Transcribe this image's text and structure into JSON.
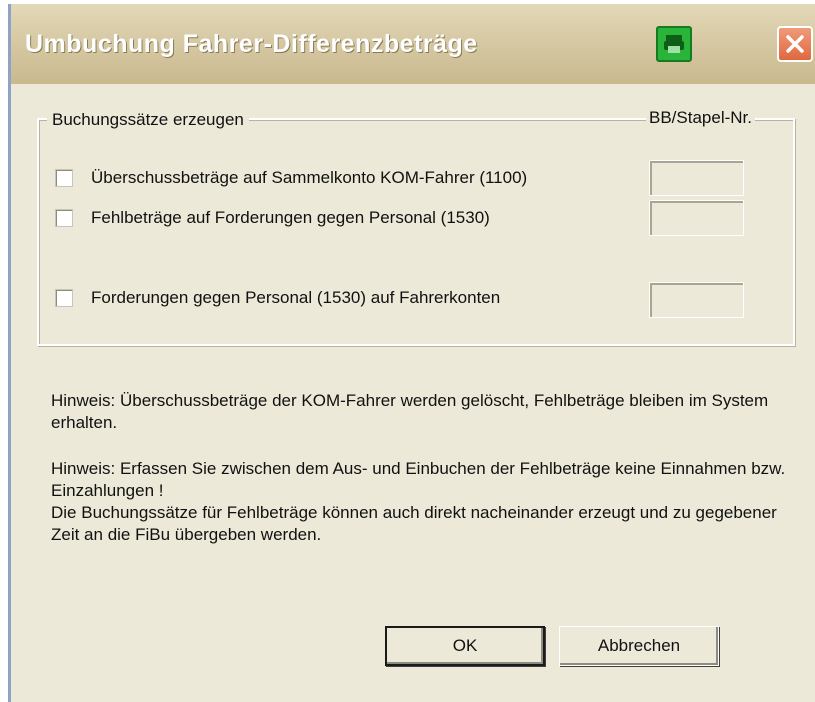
{
  "window": {
    "title": "Umbuchung Fahrer-Differenzbeträge"
  },
  "titlebar_icons": {
    "app_icon": "green-printer-icon",
    "close_icon": "close-x-icon",
    "close_color": "#e0683f"
  },
  "group": {
    "label": "Buchungssätze erzeugen",
    "column_header": "BB/Stapel-Nr.",
    "options": [
      {
        "label": "Überschussbeträge auf Sammelkonto KOM-Fahrer (1100)",
        "checked": false,
        "batch_number": ""
      },
      {
        "label": "Fehlbeträge auf Forderungen gegen Personal (1530)",
        "checked": false,
        "batch_number": ""
      },
      {
        "label": "Forderungen gegen Personal (1530) auf Fahrerkonten",
        "checked": false,
        "batch_number": ""
      }
    ]
  },
  "hints": {
    "hint1": "Hinweis: Überschussbeträge der KOM-Fahrer werden gelöscht, Fehlbeträge bleiben im System erhalten.",
    "hint2": "Hinweis: Erfassen Sie zwischen dem Aus- und Einbuchen der Fehlbeträge keine Einnahmen bzw. Einzahlungen !",
    "hint3": "Die Buchungssätze für Fehlbeträge können auch direkt nacheinander erzeugt und zu gegebener Zeit an die FiBu übergeben werden."
  },
  "buttons": {
    "ok": "OK",
    "cancel": "Abbrechen"
  }
}
